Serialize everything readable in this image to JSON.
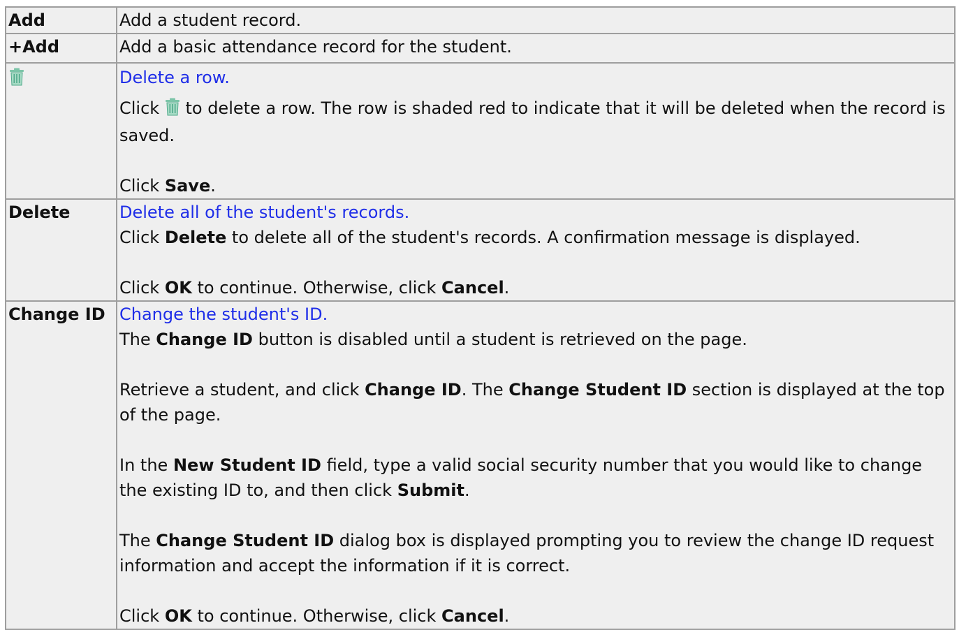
{
  "rows": [
    {
      "label": "Add",
      "desc": "Add a student record."
    },
    {
      "label": "+Add",
      "desc": "Add a basic attendance record for the student."
    },
    {
      "label_icon": "trash-icon",
      "link": "Delete a row.",
      "p1_pre": "Click",
      "p1_post": "to delete a row. The row is shaded red to indicate that it will be deleted when the record is saved.",
      "p2_pre": "Click",
      "p2_b1": "Save",
      "p2_post": "."
    },
    {
      "label": "Delete",
      "link": "Delete all of the student's records.",
      "p1_pre": "Click",
      "p1_b1": "Delete",
      "p1_post": "to delete all of the student's records. A confirmation message is displayed.",
      "p2_pre": "Click",
      "p2_b1": "OK",
      "p2_mid": "to continue. Otherwise, click",
      "p2_b2": "Cancel",
      "p2_post": "."
    },
    {
      "label": "Change ID",
      "link": "Change the student's ID.",
      "p1_pre": "The",
      "p1_b1": "Change ID",
      "p1_post": "button is disabled until a student is retrieved on the page.",
      "p2_pre": "Retrieve a student, and click",
      "p2_b1": "Change ID",
      "p2_mid": ". The",
      "p2_b2": "Change Student ID",
      "p2_post": "section is displayed at the top of the page.",
      "p3_pre": "In the",
      "p3_b1": "New Student ID",
      "p3_mid": "field, type a valid social security number that you would like to change the existing ID to, and then click",
      "p3_b2": "Submit",
      "p3_post": ".",
      "p4_pre": "The",
      "p4_b1": "Change Student ID",
      "p4_post": "dialog box is displayed prompting you to review the change ID request information and accept the information if it is correct.",
      "p5_pre": "Click",
      "p5_b1": "OK",
      "p5_mid": "to continue. Otherwise, click",
      "p5_b2": "Cancel",
      "p5_post": "."
    }
  ],
  "colors": {
    "link": "#1f2ee8",
    "row_background": "#efefef",
    "border": "#9e9e9e",
    "trash_icon": "#4fa98a"
  }
}
